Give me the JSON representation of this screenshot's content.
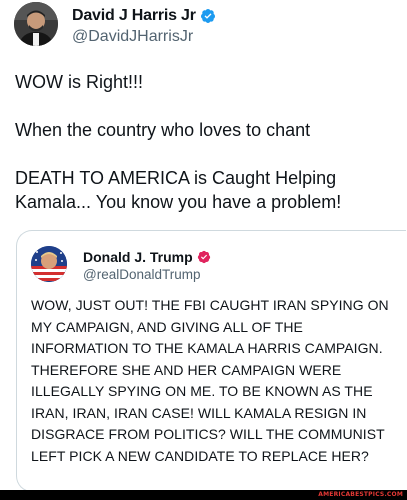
{
  "tweet": {
    "author": {
      "name": "David J Harris Jr",
      "handle": "@DavidJHarrisJr",
      "verified_badge": "verified-badge-icon",
      "badge_color": "#1d9bf0"
    },
    "paragraphs": [
      "WOW is Right!!!",
      "When the country who loves to chant",
      "DEATH TO AMERICA is Caught Helping Kamala... You know you have a problem!"
    ]
  },
  "quote": {
    "author": {
      "name": "Donald J. Trump",
      "handle": "@realDonaldTrump",
      "verified_badge": "verified-badge-icon",
      "badge_color": "#e0245e"
    },
    "text": "WOW, JUST OUT! THE FBI CAUGHT IRAN SPYING ON MY CAMPAIGN, AND GIVING ALL OF THE INFORMATION TO THE KAMALA HARRIS CAMPAIGN. THEREFORE SHE AND HER CAMPAIGN WERE ILLEGALLY SPYING ON ME. TO BE KNOWN AS THE IRAN, IRAN, IRAN CASE! WILL KAMALA RESIGN IN DISGRACE FROM POLITICS? WILL THE COMMUNIST LEFT PICK A NEW CANDIDATE TO REPLACE HER?"
  },
  "watermark": "AMERICABESTPICS.COM"
}
